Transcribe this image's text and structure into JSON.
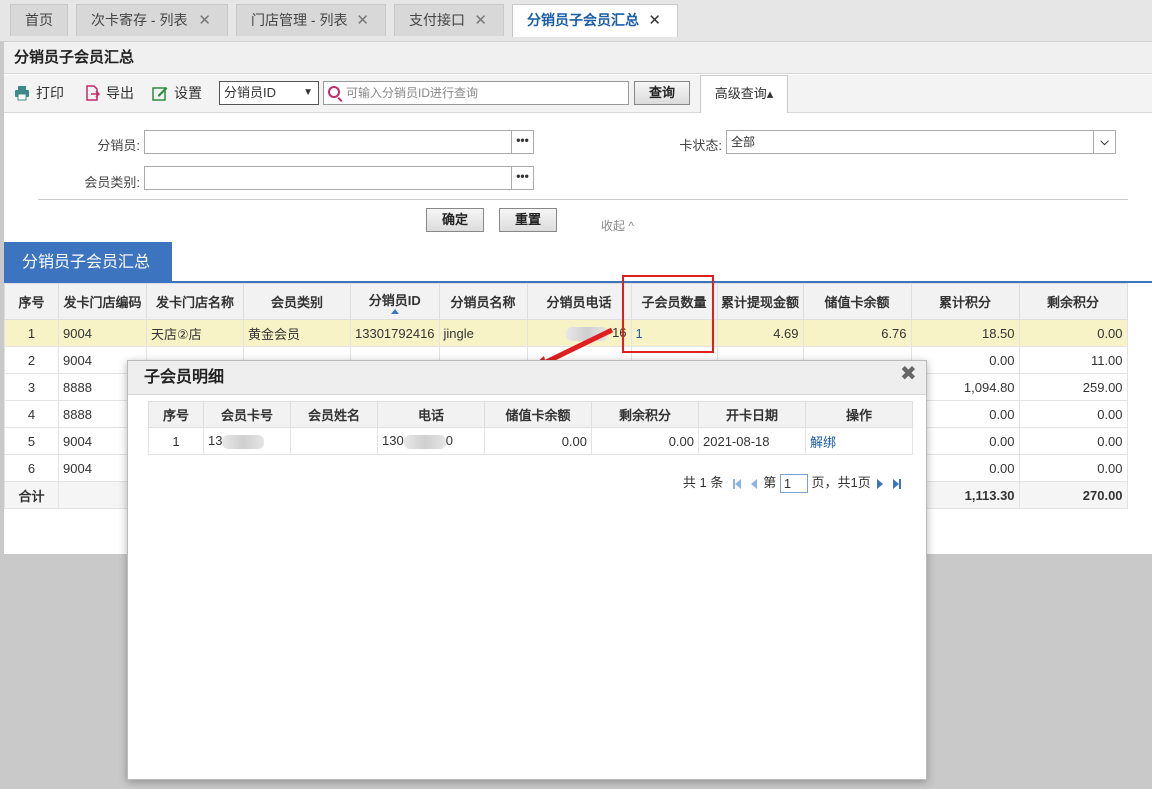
{
  "tabs": [
    {
      "label": "首页",
      "closable": false
    },
    {
      "label": "次卡寄存 - 列表",
      "closable": true
    },
    {
      "label": "门店管理 - 列表",
      "closable": true
    },
    {
      "label": "支付接口",
      "closable": true
    },
    {
      "label": "分销员子会员汇总",
      "closable": true,
      "active": true
    }
  ],
  "tab_close_glyph": "✕",
  "page_title": "分销员子会员汇总",
  "toolbar": {
    "print": "打印",
    "export": "导出",
    "settings": "设置",
    "search_field": "分销员ID",
    "search_placeholder": "可输入分销员ID进行查询",
    "query": "查询",
    "advanced": "高级查询▴"
  },
  "filters": {
    "distributor_label": "分销员:",
    "distributor_value": "",
    "member_type_label": "会员类别:",
    "member_type_value": "",
    "card_status_label": "卡状态:",
    "card_status_value": "全部",
    "confirm": "确定",
    "reset": "重置",
    "collapse": "收起 ^"
  },
  "section_title": "分销员子会员汇总",
  "grid": {
    "headers": [
      "序号",
      "发卡门店编码",
      "发卡门店名称",
      "会员类别",
      "分销员ID",
      "分销员名称",
      "分销员电话",
      "子会员数量",
      "累计提现金额",
      "储值卡余额",
      "累计积分",
      "剩余积分"
    ],
    "rows": [
      [
        "1",
        "9004",
        "天店②店",
        "黄金会员",
        "13301792416",
        "jingle",
        "16",
        "1",
        "4.69",
        "6.76",
        "18.50",
        "0.00"
      ],
      [
        "2",
        "9004",
        "",
        "",
        "",
        "",
        "",
        "",
        "",
        "",
        "0.00",
        "11.00"
      ],
      [
        "3",
        "8888",
        "",
        "",
        "",
        "",
        "",
        "",
        "",
        "",
        "1,094.80",
        "259.00"
      ],
      [
        "4",
        "8888",
        "",
        "",
        "",
        "",
        "",
        "",
        "",
        "",
        "0.00",
        "0.00"
      ],
      [
        "5",
        "9004",
        "",
        "",
        "",
        "",
        "",
        "",
        "",
        "",
        "0.00",
        "0.00"
      ],
      [
        "6",
        "9004",
        "",
        "",
        "",
        "",
        "",
        "",
        "",
        "",
        "0.00",
        "0.00"
      ]
    ],
    "total_label": "合计",
    "total_points": "1,113.30",
    "total_remaining": "270.00"
  },
  "modal": {
    "title": "子会员明细",
    "close": "✖",
    "headers": [
      "序号",
      "会员卡号",
      "会员姓名",
      "电话",
      "储值卡余额",
      "剩余积分",
      "开卡日期",
      "操作"
    ],
    "rows": [
      {
        "no": "1",
        "card": "13",
        "name": "",
        "phone_a": "130",
        "phone_b": "0",
        "balance": "0.00",
        "points": "0.00",
        "date": "2021-08-18",
        "action": "解绑"
      }
    ],
    "pager": {
      "total": "共 1 条",
      "page_prefix": "第",
      "page": "1",
      "page_suffix": "页，共1页"
    }
  },
  "colors": {
    "accent": "#3d74bf",
    "highlight": "#e02020",
    "selected_row": "#f7f3c6"
  }
}
